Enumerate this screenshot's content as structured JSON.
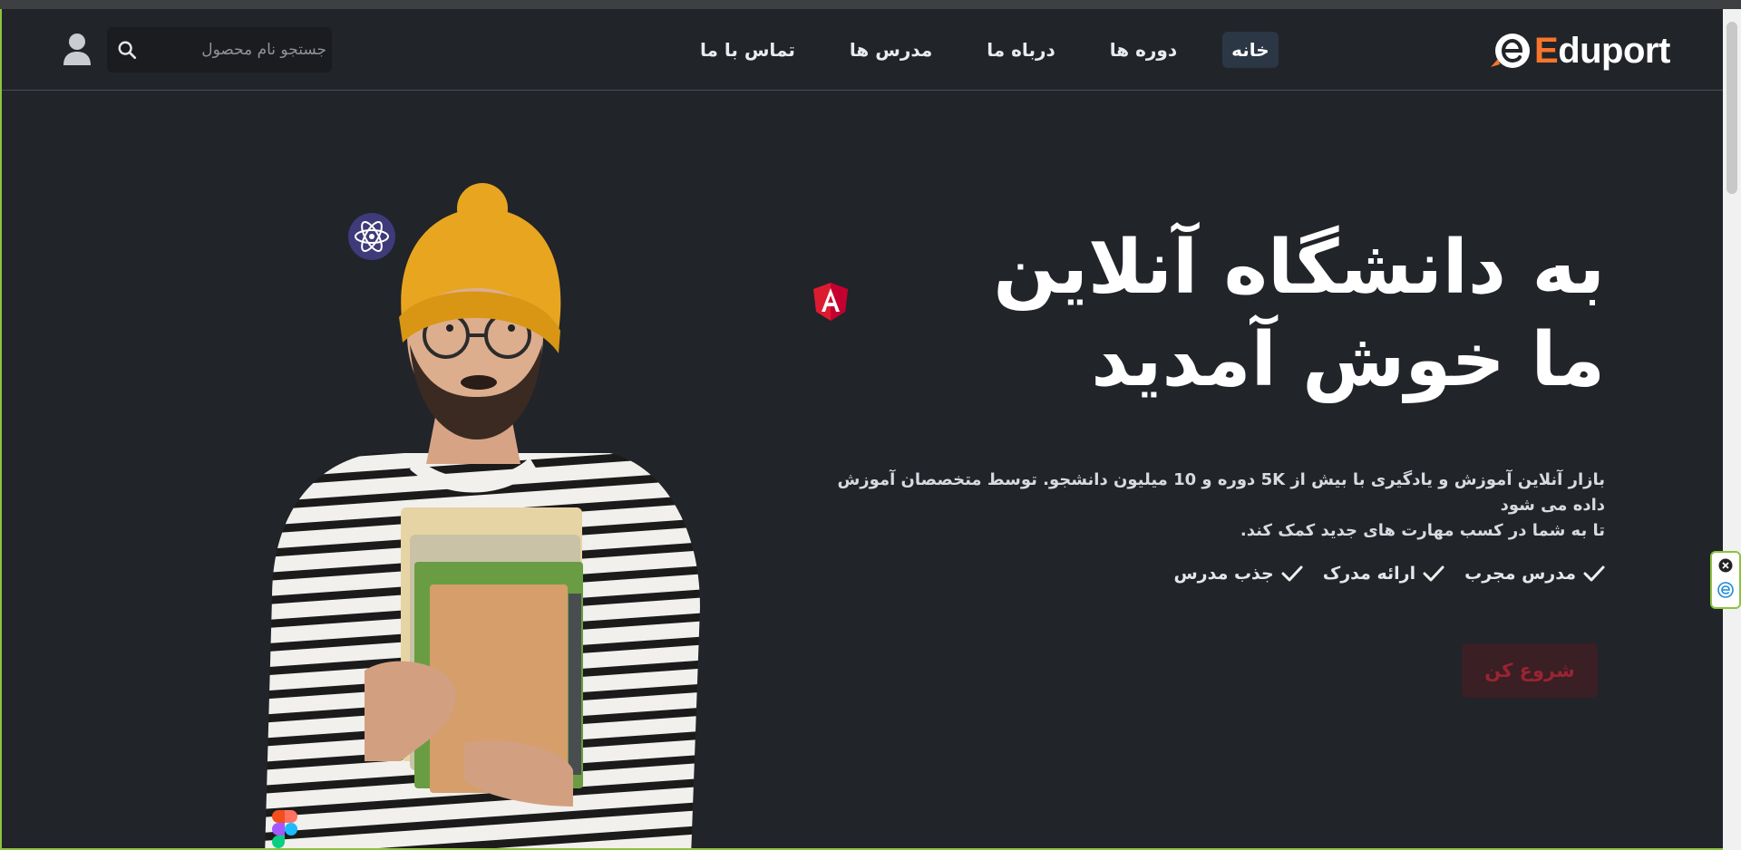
{
  "header": {
    "brand_name": "Eduport",
    "brand_first_letter": "E",
    "brand_rest": "duport",
    "nav_items": [
      {
        "label": "خانه",
        "active": true
      },
      {
        "label": "دوره ها",
        "active": false
      },
      {
        "label": "درباه ما",
        "active": false
      },
      {
        "label": "مدرس ها",
        "active": false
      },
      {
        "label": "تماس با ما",
        "active": false
      }
    ],
    "search": {
      "placeholder": "جستجو نام محصول",
      "value": ""
    },
    "icons": {
      "search": "search-icon",
      "user": "user-icon"
    }
  },
  "hero": {
    "title_line1": "به دانشگاه آنلاین",
    "title_line2": "ما خوش آمدید",
    "description_line1": "بازار آنلاین آموزش و یادگیری با بیش از 5K دوره و 10 میلیون دانشجو. توسط متخصصان آموزش داده می شود",
    "description_line2": "تا به شما در کسب مهارت های جدید کمک کند.",
    "features": [
      "مدرس مجرب",
      "ارائه مدرک",
      "جذب مدرس"
    ],
    "cta_label": "شروع کن",
    "badges": [
      "atom-icon",
      "angular-icon",
      "figma-icon"
    ],
    "illustration": "student-with-books-illustration"
  },
  "colors": {
    "background": "#212429",
    "brand_orange": "#f7752d",
    "cta_text": "#9a2430",
    "cta_bg": "#3a1f25",
    "active_nav_bg": "#2b3744"
  }
}
